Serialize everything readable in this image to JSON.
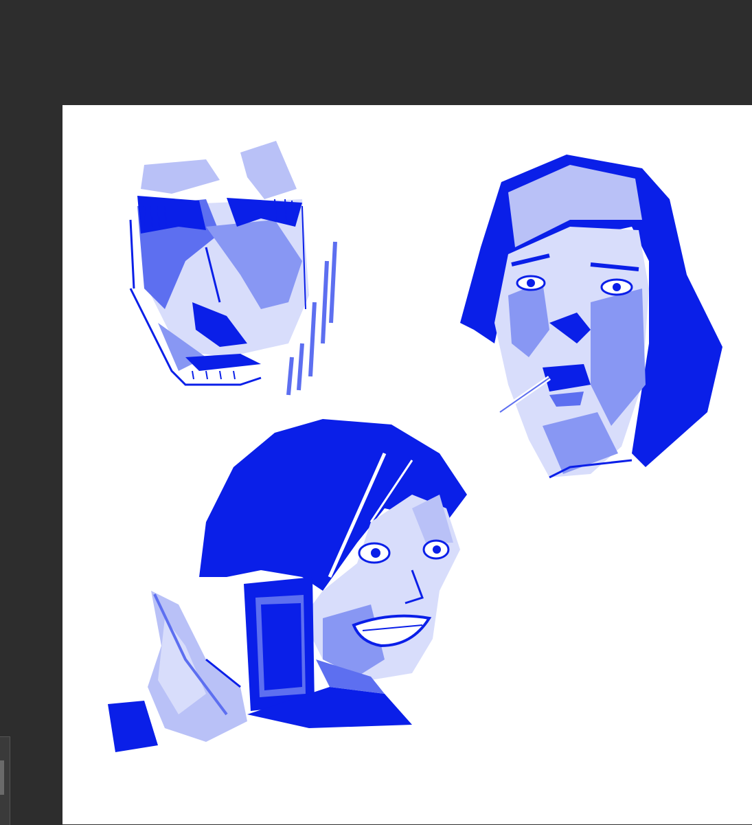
{
  "app": {
    "description_visible_text": ""
  },
  "colors": {
    "workspace_bg": "#2d2d2d",
    "canvas_bg": "#ffffff",
    "ink_dark": "#0a1fe8",
    "ink_mid": "#5d6ff0",
    "ink_light": "#b9c1f7"
  },
  "canvas": {
    "sketches": [
      {
        "name": "sketch-old-man"
      },
      {
        "name": "sketch-nun"
      },
      {
        "name": "sketch-woman-with-phone"
      }
    ]
  }
}
